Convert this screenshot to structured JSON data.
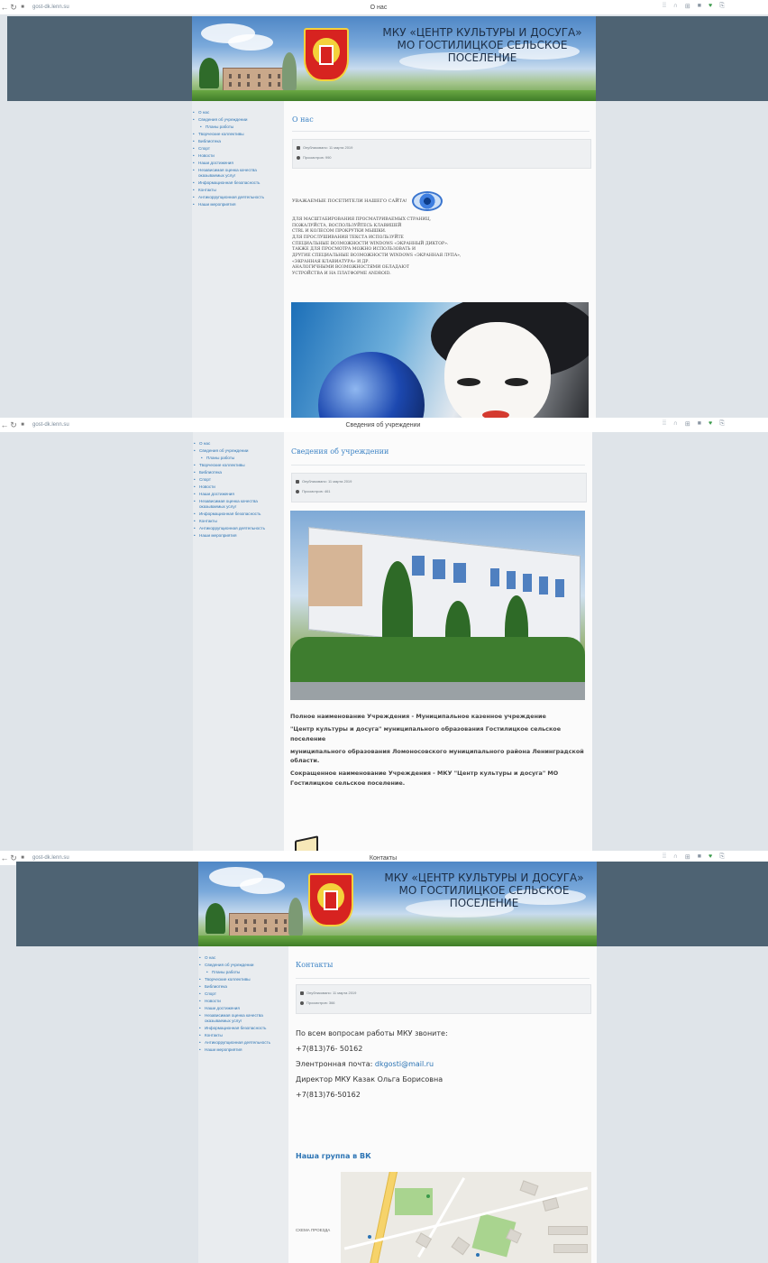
{
  "site": {
    "title_line1": "МКУ «ЦЕНТР КУЛЬТУРЫ И ДОСУГА»",
    "title_line2": "МО ГОСТИЛИЦКОЕ СЕЛЬСКОЕ ПОСЕЛЕНИЕ"
  },
  "browser": {
    "url": "gost-dk.lenn.su",
    "tab_titles": [
      "О нас",
      "Сведения об учреждении",
      "Контакты"
    ]
  },
  "nav": {
    "items": [
      {
        "label": "О нас"
      },
      {
        "label": "Сведения об учреждении"
      },
      {
        "label": "Планы работы",
        "sub": true
      },
      {
        "label": "Творческие коллективы"
      },
      {
        "label": "Библиотека"
      },
      {
        "label": "Спорт"
      },
      {
        "label": "Новости"
      },
      {
        "label": "Наши достижения"
      },
      {
        "label": "Независимая оценка качества оказываемых услуг"
      },
      {
        "label": "Информационная безопасность"
      },
      {
        "label": "Контакты"
      },
      {
        "label": "Антикоррупционная деятельность"
      },
      {
        "label": "Наши мероприятия"
      }
    ]
  },
  "page1": {
    "heading": "О нас",
    "published": "Опубликовано: 11 марта 2019",
    "views": "Просмотров: 990",
    "notice_title": "УВАЖАЕМЫЕ ПОСЕТИТЕЛИ НАШЕГО САЙТА!",
    "notice_lines": [
      "ДЛЯ МАСШТАБИРОВАНИЯ ПРОСМАТРИВАЕМЫХ СТРАНИЦ,",
      "ПОЖАЛУЙСТА, ВОСПОЛЬЗУЙТЕСЬ КЛАВИШЕЙ",
      "CTRL и КОЛЕСОМ ПРОКРУТКИ МЫШКИ.",
      "ДЛЯ ПРОСЛУШИВАНИЯ ТЕКСТА ИСПОЛЬЗУЙТЕ",
      "СПЕЦИАЛЬНЫЕ ВОЗМОЖНОСТИ WINDOWS «ЭКРАННЫЙ ДИКТОР».",
      "ТАКЖЕ ДЛЯ ПРОСМОТРА МОЖНО ИСПОЛЬЗОВАТЬ И",
      "ДРУГИЕ СПЕЦИАЛЬНЫЕ ВОЗМОЖНОСТИ WINDOWS «ЭКРАННАЯ ЛУПА»,",
      "«ЭКРАННАЯ КЛАВИАТУРА» И ДР.",
      "АНАЛОГИЧНЫМИ ВОЗМОЖНОСТЯМИ ОБЛАДАЮТ",
      "УСТРОЙСТВА И НА ПЛАТФОРМЕ ANDROID."
    ]
  },
  "page2": {
    "heading": "Сведения об учреждении",
    "published": "Опубликовано: 11 марта 2019",
    "views": "Просмотров: 461",
    "paragraphs": [
      "Полное наименование Учреждения - Муниципальное казенное учреждение",
      "\"Центр культуры и досуга\" муниципального образования Гостилицкое сельское поселение",
      "муниципального образования Ломоносовского муниципального района Ленинградской области.",
      "Сокращенное наименование Учреждения - МКУ \"Центр культуры и досуга\" МО Гостилицкое сельское поселение."
    ]
  },
  "page3": {
    "heading": "Контакты",
    "published": "Опубликовано: 11 марта 2019",
    "views": "Просмотров: 366",
    "line1": "По всем вопросам работы МКУ звоните:",
    "phone1": "+7(813)76- 50162",
    "email_label": "Элентронная почта:",
    "email": "dkgosti@mail.ru",
    "director": "Директор МКУ  Казак Ольга Борисовна",
    "phone2": "+7(813)76-50162",
    "vk_link": "Наша группа в ВК",
    "map_label": "СХЕМА ПРОЕЗДА"
  },
  "colors": {
    "header_band": "#4e6373",
    "link": "#2c74b4",
    "sidebar_bg": "#e9ecef",
    "page_bg": "#dfe4e9"
  }
}
